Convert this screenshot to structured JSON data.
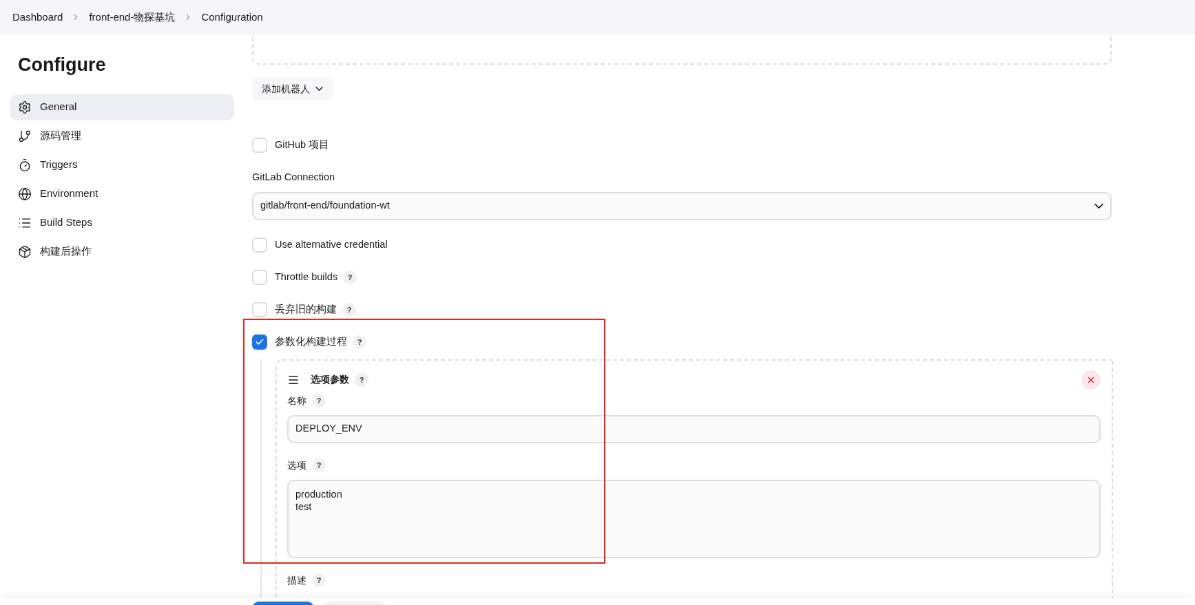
{
  "breadcrumbs": [
    {
      "label": "Dashboard"
    },
    {
      "label": "front-end-物探基坑"
    },
    {
      "label": "Configuration"
    }
  ],
  "sidebar": {
    "title": "Configure",
    "items": [
      {
        "label": "General",
        "selected": true
      },
      {
        "label": "源码管理",
        "selected": false
      },
      {
        "label": "Triggers",
        "selected": false
      },
      {
        "label": "Environment",
        "selected": false
      },
      {
        "label": "Build Steps",
        "selected": false
      },
      {
        "label": "构建后操作",
        "selected": false
      }
    ]
  },
  "add_robot_button": {
    "label": "添加机器人"
  },
  "options": [
    {
      "kind": "checkbox",
      "label": "GitHub 项目",
      "checked": false
    },
    {
      "kind": "select",
      "label": "GitLab Connection",
      "value": "gitlab/front-end/foundation-wt"
    },
    {
      "kind": "checkbox",
      "label": "Use alternative credential",
      "checked": false
    },
    {
      "kind": "checkbox",
      "label": "Throttle builds",
      "checked": false,
      "help": "?"
    },
    {
      "kind": "checkbox",
      "label": "丢弃旧的构建",
      "checked": false,
      "help": "?"
    },
    {
      "kind": "checkbox",
      "label": "参数化构建过程",
      "checked": true,
      "help": "?"
    }
  ],
  "parameter": {
    "title": "选项参数",
    "help": "?",
    "fields": [
      {
        "kind": "input",
        "label": "名称",
        "help": "?",
        "value": "DEPLOY_ENV"
      },
      {
        "kind": "textarea",
        "label": "选项",
        "help": "?",
        "value": "production\ntest"
      },
      {
        "kind": "label",
        "label": "描述",
        "help": "?"
      }
    ]
  }
}
